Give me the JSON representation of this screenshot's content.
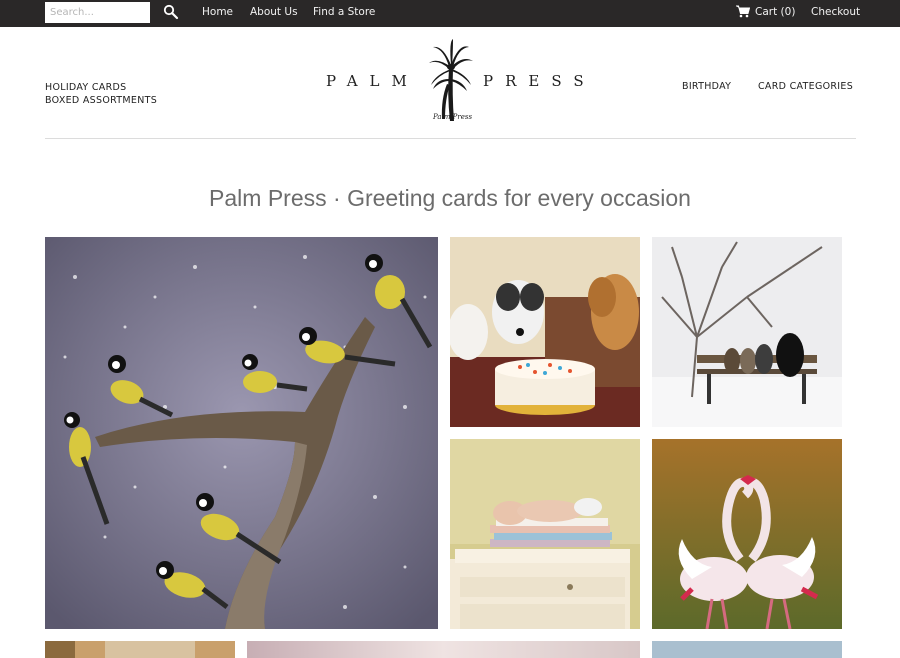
{
  "topbar": {
    "search_placeholder": "Search...",
    "links": {
      "home": "Home",
      "about": "About Us",
      "store": "Find a Store"
    },
    "cart": "Cart (0)",
    "checkout": "Checkout"
  },
  "header": {
    "nav_left": [
      "HOLIDAY CARDS",
      "BOXED ASSORTMENTS"
    ],
    "nav_right": [
      "BIRTHDAY",
      "CARD CATEGORIES"
    ],
    "logo_left": "PALM",
    "logo_right": "PRESS",
    "logo_signature": "Palm Press"
  },
  "tagline": "Palm Press · Greeting cards for every occasion",
  "icons": {
    "search": "search-icon",
    "cart": "cart-icon"
  },
  "colors": {
    "topbar": "#2a2828",
    "tagline": "#6c6c6c"
  }
}
